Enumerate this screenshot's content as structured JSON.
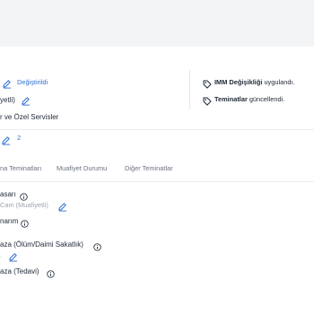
{
  "header": {
    "bg": "#f3f4f6"
  },
  "left": {
    "degistirildi": "Değiştirildi",
    "muafiyetli": "yetli)",
    "servisler": "r ve Özel Servisler",
    "count": "2"
  },
  "right": {
    "item1_bold": "IMM Değişikliği",
    "item1_rest": " uygulandı.",
    "item2_bold": "Teminatlar",
    "item2_rest": " güncellendi."
  },
  "tabs": [
    "na Teminatları",
    "Muafiyet Durumu",
    "Diğer Teminatlar"
  ],
  "items": [
    {
      "title": "asarı",
      "sub": "Cam (Muafiyetli)"
    },
    {
      "title": "narım",
      "sub": ""
    },
    {
      "title": "aza (Ölüm/Daimi Sakatlık)",
      "sub": "."
    },
    {
      "title": "aza (Tedavi)",
      "sub": ""
    }
  ],
  "colors": {
    "accent": "#2f6fd1",
    "muted": "#9ca3af",
    "text": "#1f2937"
  }
}
